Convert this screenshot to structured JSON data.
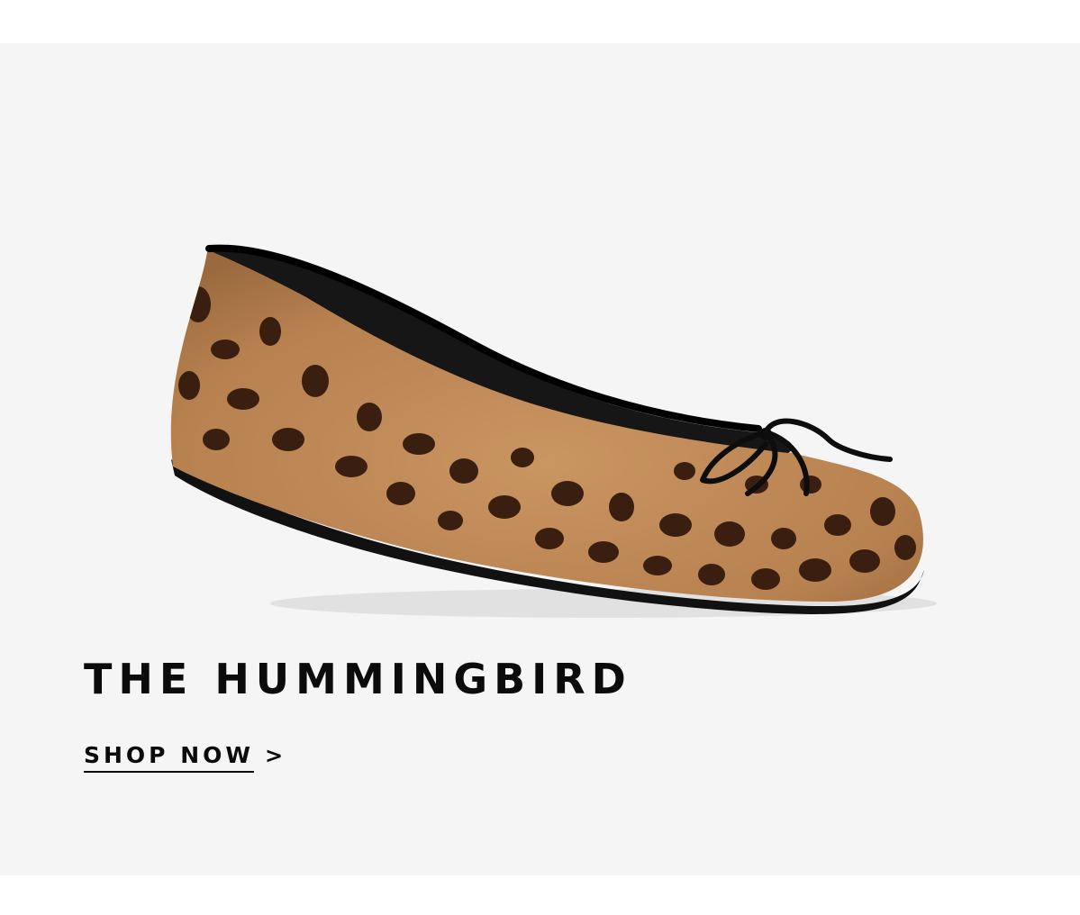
{
  "hero": {
    "product_name": "THE HUMMINGBIRD",
    "cta_label": "SHOP NOW",
    "cta_arrow": ">",
    "image_alt": "leopard print ballet flat with black bow",
    "background_color": "#f5f5f5",
    "text_color": "#0b0b0b"
  }
}
